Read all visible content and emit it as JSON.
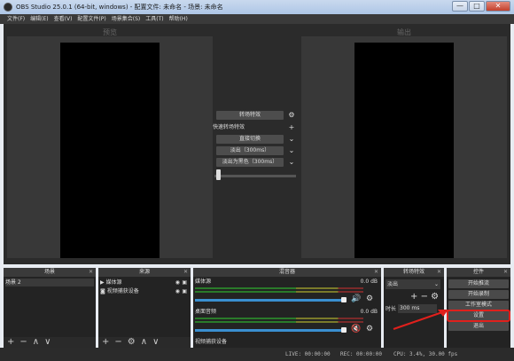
{
  "window": {
    "title": "OBS Studio 25.0.1 (64-bit, windows) - 配置文件: 未命名 - 场景: 未命名",
    "min": "—",
    "max": "□",
    "close": "✕"
  },
  "menu": [
    "文件(F)",
    "编辑(E)",
    "查看(V)",
    "配置文件(P)",
    "场景集合(S)",
    "工具(T)",
    "帮助(H)"
  ],
  "preview": {
    "title": "预览"
  },
  "output": {
    "title": "输出"
  },
  "transition": {
    "effect_label": "转场特效",
    "quick_label": "快速转场特效",
    "cut_label": "直接切换",
    "fade_label": "淡出（300ms）",
    "fade_black_label": "淡出为黑色（300ms）",
    "gear_icon": "⚙",
    "add_icon": "+",
    "dropdown_icon": "⌄"
  },
  "scenes": {
    "title": "场景",
    "items": [
      "场景 2"
    ],
    "footer": [
      "+",
      "−",
      "∧",
      "∨"
    ]
  },
  "sources": {
    "title": "来源",
    "items": [
      {
        "icon": "play-icon",
        "glyph": "▶",
        "label": "媒体源"
      },
      {
        "icon": "camera-icon",
        "glyph": "◙",
        "label": "视频捕获设备"
      }
    ],
    "footer": [
      "+",
      "−",
      "⚙",
      "∧",
      "∨"
    ]
  },
  "mixer": {
    "title": "混音器",
    "channels": [
      {
        "name": "媒体源",
        "db": "0.0 dB",
        "muted": false,
        "volume_fraction": 0.9
      },
      {
        "name": "桌面音频",
        "db": "0.0 dB",
        "muted": true,
        "volume_fraction": 0.9
      },
      {
        "name": "视频捕获设备",
        "db": "",
        "muted": false,
        "volume_fraction": 0.9
      }
    ],
    "ticks": [
      "-60",
      "-55",
      "-50",
      "-45",
      "-40",
      "-35",
      "-30",
      "-25",
      "-20",
      "-15",
      "-10",
      "-5",
      "0"
    ]
  },
  "transitions_dock": {
    "title": "转场特效",
    "selected": "淡出",
    "duration_label": "时长",
    "duration_value": "300 ms"
  },
  "controls": {
    "title": "控件",
    "buttons": [
      "开始推流",
      "开始录制",
      "工作室模式",
      "设置",
      "退出"
    ]
  },
  "status": {
    "live": "LIVE: 00:00:00",
    "rec": "REC: 00:00:00",
    "cpu": "CPU: 3.4%, 30.00 fps"
  },
  "colors": {
    "annotation": "#e0201c"
  }
}
